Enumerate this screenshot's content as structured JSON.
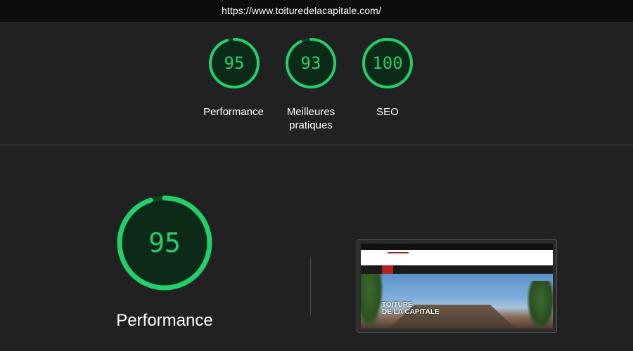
{
  "url": "https://www.toituredelacapitale.com/",
  "colors": {
    "background": "#212121",
    "gauge_green": "#1fd16a",
    "gauge_track": "#0e3d20"
  },
  "scores": [
    {
      "value": "95",
      "label": "Performance",
      "fraction": 0.95
    },
    {
      "value": "93",
      "label_line1": "Meilleures",
      "label_line2": "pratiques",
      "fraction": 0.93
    },
    {
      "value": "100",
      "label": "SEO",
      "fraction": 1.0
    }
  ],
  "performance": {
    "value": "95",
    "label": "Performance",
    "fraction": 0.95
  },
  "thumbnail": {
    "hero_title_line1": "TOITURE",
    "hero_title_line2": "DE LA CAPITALE"
  }
}
